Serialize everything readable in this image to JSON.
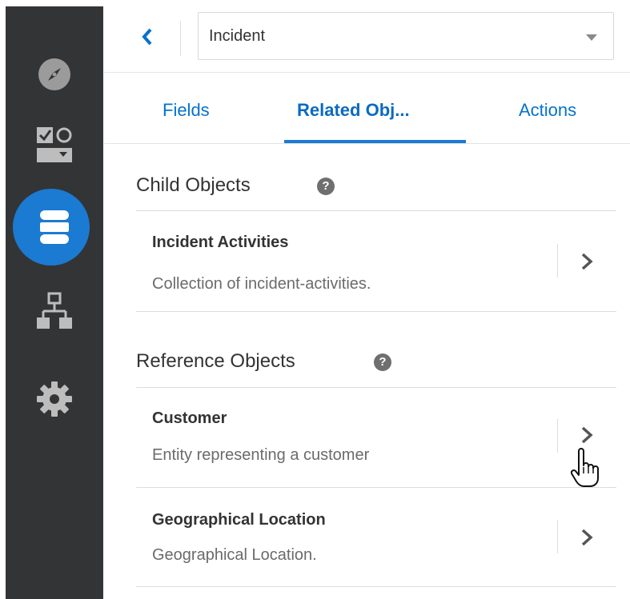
{
  "rail": {
    "icons": [
      "compass-icon",
      "forms-icon",
      "database-icon",
      "hierarchy-icon",
      "gear-icon"
    ],
    "active": "database-icon",
    "active_color": "#1b7ad1"
  },
  "header": {
    "back_icon": "chevron-left-icon",
    "select_value": "Incident"
  },
  "tabs": [
    {
      "label": "Fields",
      "active": false
    },
    {
      "label": "Related Obj...",
      "active": true
    },
    {
      "label": "Actions",
      "active": false
    }
  ],
  "child_section": {
    "title": "Child Objects",
    "items": [
      {
        "title": "Incident Activities",
        "description": "Collection of incident-activities."
      }
    ]
  },
  "reference_section": {
    "title": "Reference Objects",
    "items": [
      {
        "title": "Customer",
        "description": "Entity representing a customer"
      },
      {
        "title": "Geographical Location",
        "description": "Geographical Location."
      }
    ]
  },
  "help_glyph": "?",
  "colors": {
    "accent": "#0572ce",
    "rail_bg": "#333436"
  }
}
